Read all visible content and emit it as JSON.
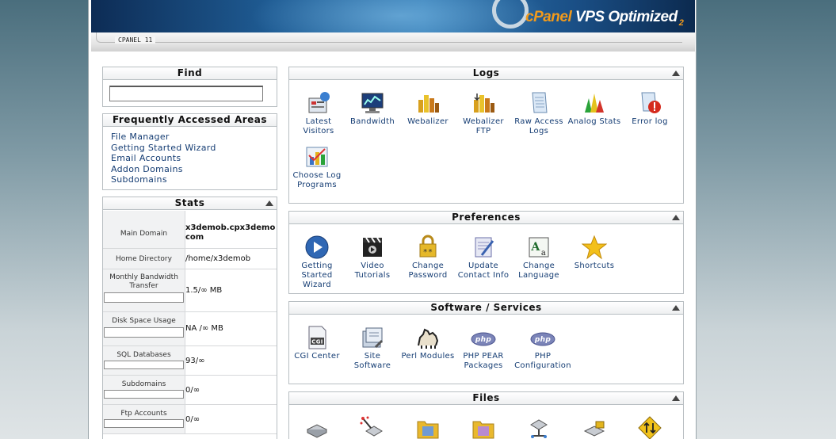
{
  "header": {
    "brand_prefix": "cPanel",
    "brand_suffix": " VPS Optimized",
    "brand_number": "2",
    "version_label": "CPANEL 11"
  },
  "find": {
    "title": "Find",
    "value": ""
  },
  "frequent": {
    "title": "Frequently Accessed Areas",
    "items": [
      "File Manager",
      "Getting Started Wizard",
      "Email Accounts",
      "Addon Domains",
      "Subdomains"
    ]
  },
  "stats": {
    "title": "Stats",
    "rows": [
      {
        "label": "Main Domain",
        "value": "x3demob.cpx3demo com"
      },
      {
        "label": "Home Directory",
        "value": "/home/x3demob"
      },
      {
        "label": "Monthly Bandwidth Transfer",
        "value": "1.5/∞ MB"
      },
      {
        "label": "Disk Space Usage",
        "value": "NA /∞ MB"
      },
      {
        "label": "SQL Databases",
        "value": "93/∞"
      },
      {
        "label": "Subdomains",
        "value": "0/∞"
      },
      {
        "label": "Ftp Accounts",
        "value": "0/∞"
      }
    ]
  },
  "logs": {
    "title": "Logs",
    "items": [
      {
        "label": "Latest Visitors",
        "icon": "latest-visitors-icon"
      },
      {
        "label": "Bandwidth",
        "icon": "bandwidth-icon"
      },
      {
        "label": "Webalizer",
        "icon": "webalizer-icon"
      },
      {
        "label": "Webalizer FTP",
        "icon": "webalizer-ftp-icon"
      },
      {
        "label": "Raw Access Logs",
        "icon": "raw-access-logs-icon"
      },
      {
        "label": "Analog Stats",
        "icon": "analog-stats-icon"
      },
      {
        "label": "Error log",
        "icon": "error-log-icon"
      },
      {
        "label": "Choose Log Programs",
        "icon": "choose-log-programs-icon"
      }
    ]
  },
  "preferences": {
    "title": "Preferences",
    "items": [
      {
        "label": "Getting Started Wizard",
        "icon": "getting-started-wizard-icon"
      },
      {
        "label": "Video Tutorials",
        "icon": "video-tutorials-icon"
      },
      {
        "label": "Change Password",
        "icon": "change-password-icon"
      },
      {
        "label": "Update Contact Info",
        "icon": "update-contact-info-icon"
      },
      {
        "label": "Change Language",
        "icon": "change-language-icon"
      },
      {
        "label": "Shortcuts",
        "icon": "shortcuts-star-icon"
      }
    ]
  },
  "software": {
    "title": "Software / Services",
    "items": [
      {
        "label": "CGI Center",
        "icon": "cgi-center-icon"
      },
      {
        "label": "Site Software",
        "icon": "site-software-icon"
      },
      {
        "label": "Perl Modules",
        "icon": "perl-modules-camel-icon"
      },
      {
        "label": "PHP PEAR Packages",
        "icon": "php-pear-icon"
      },
      {
        "label": "PHP Configuration",
        "icon": "php-configuration-icon"
      }
    ]
  },
  "files": {
    "title": "Files",
    "items": [
      {
        "icon": "backups-icon"
      },
      {
        "icon": "backup-wizard-icon"
      },
      {
        "icon": "file-manager-folder-icon"
      },
      {
        "icon": "legacy-file-manager-folder-icon"
      },
      {
        "icon": "disk-usage-icon"
      },
      {
        "icon": "web-disk-icon"
      },
      {
        "icon": "ftp-accounts-icon"
      }
    ]
  },
  "colors": {
    "link": "#143c73",
    "banner_dark": "#0d2c55",
    "banner_light": "#2f78b2",
    "brand_accent": "#f29a1b"
  }
}
